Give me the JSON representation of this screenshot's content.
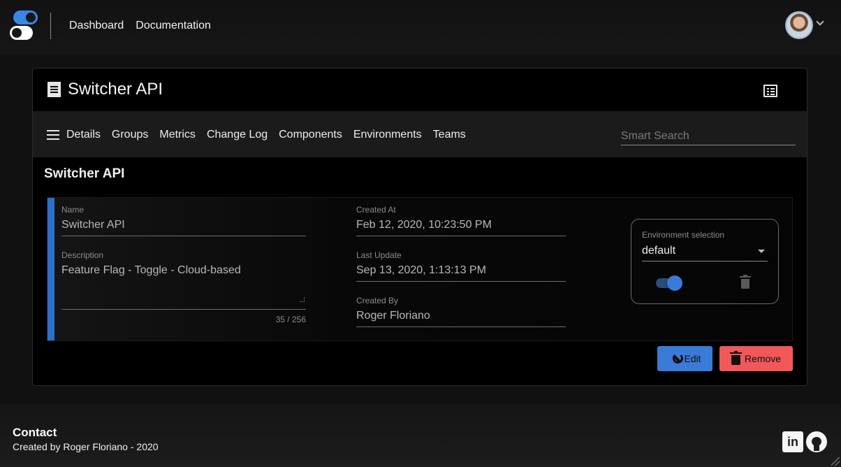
{
  "header": {
    "nav": [
      {
        "label": "Dashboard"
      },
      {
        "label": "Documentation"
      }
    ]
  },
  "card": {
    "title": "Switcher API",
    "tabs": [
      {
        "label": "Details"
      },
      {
        "label": "Groups"
      },
      {
        "label": "Metrics"
      },
      {
        "label": "Change Log"
      },
      {
        "label": "Components"
      },
      {
        "label": "Environments"
      },
      {
        "label": "Teams"
      }
    ],
    "search": {
      "placeholder": "Smart Search",
      "value": ""
    },
    "section_title": "Switcher API",
    "fields": {
      "name": {
        "label": "Name",
        "value": "Switcher API"
      },
      "description": {
        "label": "Description",
        "value": "Feature Flag - Toggle - Cloud-based",
        "counter": "35 / 256"
      },
      "created_at": {
        "label": "Created At",
        "value": "Feb 12, 2020, 10:23:50 PM"
      },
      "last_update": {
        "label": "Last Update",
        "value": "Sep 13, 2020, 1:13:13 PM"
      },
      "created_by": {
        "label": "Created By",
        "value": "Roger Floriano"
      }
    },
    "environment": {
      "label": "Environment selection",
      "selected": "default",
      "active": true
    },
    "actions": {
      "edit_label": "Edit",
      "remove_label": "Remove"
    }
  },
  "footer": {
    "title": "Contact",
    "text": "Created by Roger Floriano - 2020",
    "linkedin_glyph": "in"
  },
  "colors": {
    "accent": "#3a7ad8",
    "danger": "#f0585a",
    "background": "#000000"
  }
}
